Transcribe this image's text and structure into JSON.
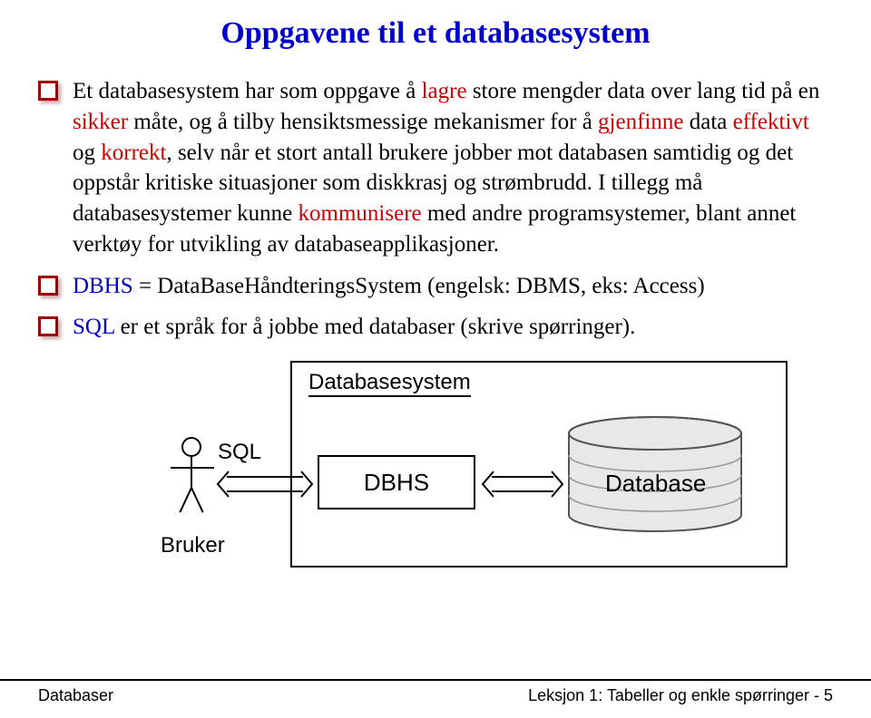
{
  "title": "Oppgavene til et databasesystem",
  "bullets": [
    {
      "pre": "Et databasesystem har som oppgave å ",
      "r1": "lagre",
      "mid1": " store mengder data over lang tid på en ",
      "r2": "sikker",
      "mid2": " måte, og å tilby hensiktsmessige mekanismer for å ",
      "r3": "gjenfinne",
      "mid3": " data ",
      "r4": "effektivt",
      "mid4": " og ",
      "r5": "korrekt",
      "mid5": ", selv når et stort antall brukere jobber mot databasen samtidig og det oppstår kritiske situasjoner som diskkrasj og strømbrudd. I tillegg må databasesystemer kunne ",
      "r6": "kommunisere",
      "post": " med andre programsystemer, blant annet verktøy for utvikling av databaseapplikasjoner."
    },
    {
      "b1": "DBHS",
      "text": " = DataBaseHåndteringsSystem (engelsk: DBMS, eks: Access)"
    },
    {
      "b1": "SQL",
      "text": " er et språk for å jobbe med databaser (skrive spørringer)."
    }
  ],
  "diagram": {
    "system": "Databasesystem",
    "sql": "SQL",
    "bruker": "Bruker",
    "dbhs": "DBHS",
    "database": "Database"
  },
  "footer": {
    "left": "Databaser",
    "right": "Leksjon 1: Tabeller og enkle spørringer - 5"
  }
}
